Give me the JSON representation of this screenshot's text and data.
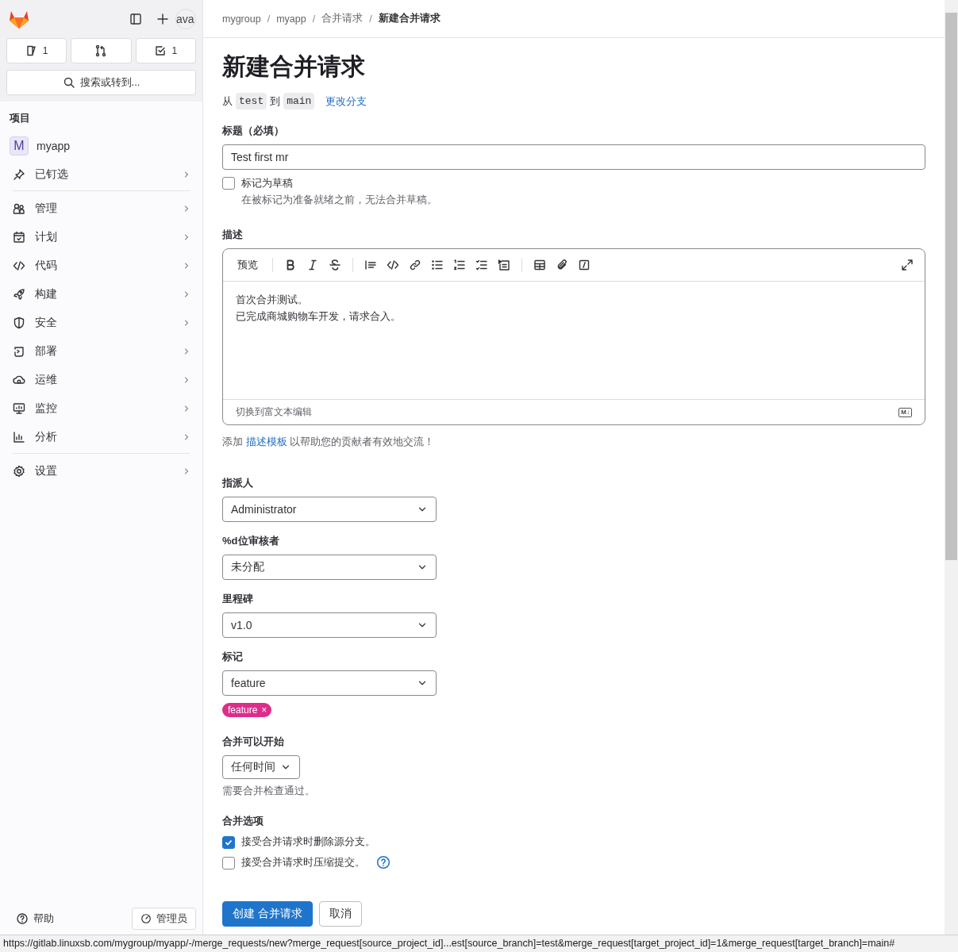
{
  "sidebar": {
    "avatar_text": "ava",
    "counters": {
      "issues": "1",
      "todos": "1"
    },
    "search": {
      "placeholder": "搜索或转到..."
    },
    "section_title": "项目",
    "project": {
      "initial": "M",
      "name": "myapp"
    },
    "item_groups": [
      [
        "已钉选"
      ],
      [
        "管理",
        "计划",
        "代码",
        "构建",
        "安全",
        "部署",
        "运维",
        "监控",
        "分析"
      ],
      [
        "设置"
      ]
    ],
    "footer": {
      "help": "帮助",
      "admin": "管理员"
    }
  },
  "breadcrumb": [
    "mygroup",
    "myapp",
    "合并请求",
    "新建合并请求"
  ],
  "breadcrumb_separator": "/",
  "page_title": "新建合并请求",
  "branches": {
    "from_word": "从",
    "source": "test",
    "to_word": "到",
    "target": "main",
    "change_link": "更改分支"
  },
  "title_field": {
    "label": "标题（必填）",
    "value": "Test first mr"
  },
  "draft": {
    "label": "标记为草稿",
    "checked": false,
    "help": "在被标记为准备就绪之前，无法合并草稿。"
  },
  "description": {
    "label": "描述",
    "preview_tab": "预览",
    "lines": [
      "首次合并测试。",
      "已完成商城购物车开发，请求合入。"
    ],
    "footer": "切换到富文本编辑",
    "markdown_badge": "M↓"
  },
  "template_hint": {
    "before": "添加 ",
    "link": "描述模板",
    "after": " 以帮助您的贡献者有效地交流！"
  },
  "selects": [
    {
      "label": "指派人",
      "value": "Administrator"
    },
    {
      "label": "%d位审核者",
      "value": "未分配"
    },
    {
      "label": "里程碑",
      "value": "v1.0"
    },
    {
      "label": "标记",
      "value": "feature"
    }
  ],
  "label_chips": [
    {
      "text": "feature",
      "color": "#dc2d8c",
      "remove": "×"
    }
  ],
  "merge_after": {
    "label": "合并可以开始",
    "value": "任何时间",
    "help": "需要合并检查通过。"
  },
  "merge_options": {
    "label": "合并选项",
    "options": [
      {
        "label": "接受合并请求时删除源分支。",
        "checked": true,
        "help_icon": false
      },
      {
        "label": "接受合并请求时压缩提交。",
        "checked": false,
        "help_icon": true
      }
    ]
  },
  "buttons": {
    "submit": "创建 合并请求",
    "cancel": "取消"
  },
  "status_bar": "https://gitlab.linuxsb.com/mygroup/myapp/-/merge_requests/new?merge_request[source_project_id]...est[source_branch]=test&merge_request[target_project_id]=1&merge_request[target_branch]=main#"
}
